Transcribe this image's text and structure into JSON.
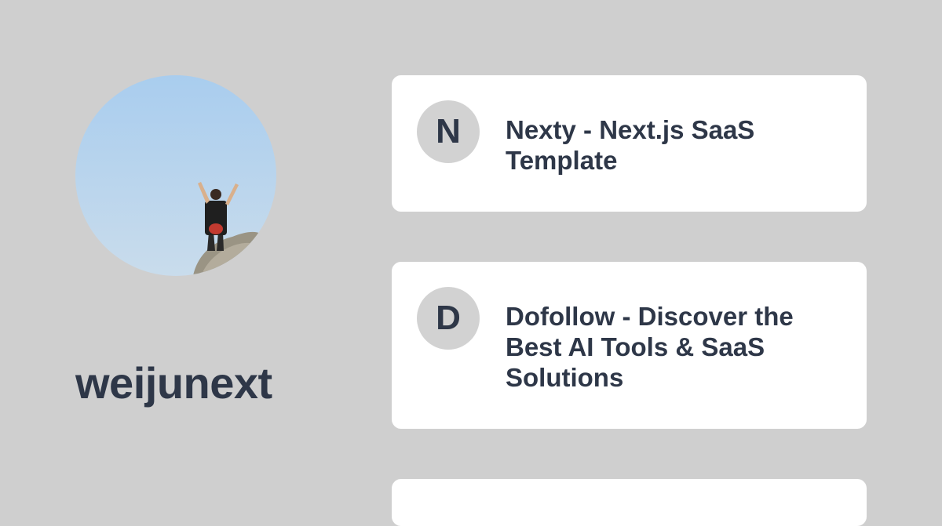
{
  "profile": {
    "avatar_description": "profile-photo",
    "username": "weijunext"
  },
  "links": [
    {
      "initial": "N",
      "title": "Nexty - Next.js SaaS Template"
    },
    {
      "initial": "D",
      "title": "Dofollow - Discover the Best AI Tools & SaaS Solutions"
    },
    {
      "initial": "",
      "title": ""
    }
  ],
  "colors": {
    "background": "#cfcfcf",
    "card": "#ffffff",
    "text": "#2e3748",
    "letter_circle": "#d2d2d2"
  }
}
